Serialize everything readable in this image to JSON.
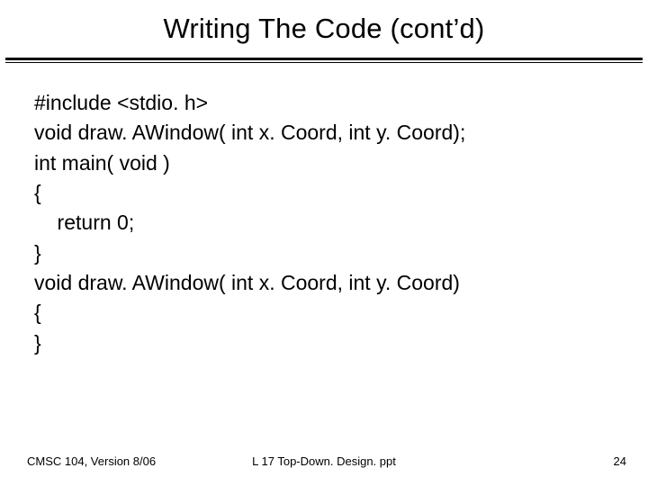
{
  "title": "Writing The Code (cont’d)",
  "code": {
    "l1": "#include <stdio. h>",
    "l2": "void draw. AWindow( int x. Coord, int y. Coord);",
    "l3": "int main( void )",
    "l4": "{",
    "l5": "    return 0;",
    "l6": "}",
    "l7": "void draw. AWindow( int x. Coord, int y. Coord)",
    "l8": "{",
    "l9": "}"
  },
  "footer": {
    "left": "CMSC 104, Version 8/06",
    "center": "L 17 Top-Down. Design. ppt",
    "right": "24"
  }
}
